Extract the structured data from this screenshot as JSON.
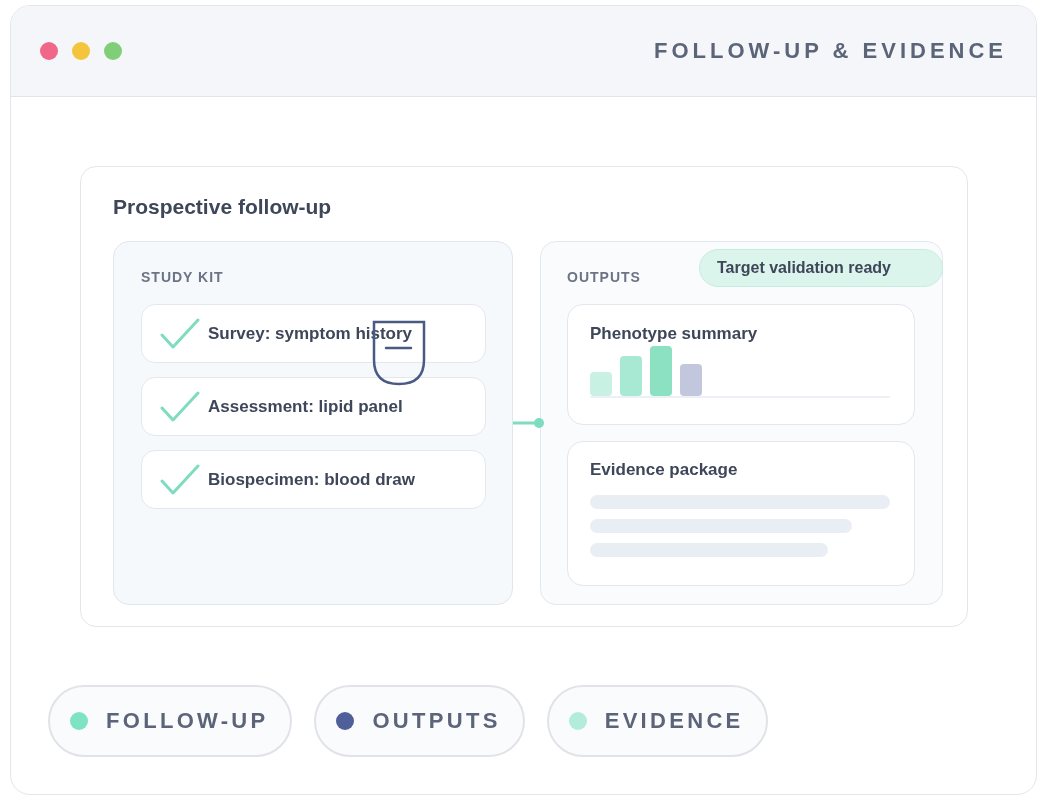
{
  "window": {
    "title": "FOLLOW-UP & EVIDENCE"
  },
  "card": {
    "title": "Prospective follow-up",
    "study_kit": {
      "heading": "STUDY KIT",
      "items": [
        {
          "label": "Survey: symptom history",
          "checked": true
        },
        {
          "label": "Assessment: lipid panel",
          "checked": true
        },
        {
          "label": "Biospecimen: blood draw",
          "checked": true
        }
      ]
    },
    "outputs": {
      "heading": "OUTPUTS",
      "badge": "Target validation ready",
      "cards": [
        {
          "kind": "chart",
          "title": "Phenotype summary"
        },
        {
          "kind": "lines",
          "title": "Evidence package"
        }
      ]
    }
  },
  "legend": [
    {
      "label": "FOLLOW-UP",
      "color": "#7de3c0"
    },
    {
      "label": "OUTPUTS",
      "color": "#4f5f9a"
    },
    {
      "label": "EVIDENCE",
      "color": "#b3ecd9"
    }
  ]
}
